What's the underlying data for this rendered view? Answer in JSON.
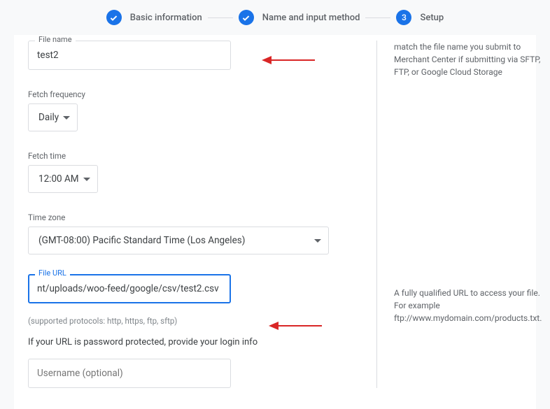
{
  "stepper": {
    "step1": "Basic information",
    "step2": "Name and input method",
    "step3_num": "3",
    "step3": "Setup"
  },
  "form": {
    "file_name_label": "File name",
    "file_name_value": "test2",
    "fetch_freq_label": "Fetch frequency",
    "fetch_freq_value": "Daily",
    "fetch_time_label": "Fetch time",
    "fetch_time_value": "12:00 AM",
    "time_zone_label": "Time zone",
    "time_zone_value": "(GMT-08:00) Pacific Standard Time (Los Angeles)",
    "file_url_label": "File URL",
    "file_url_value": "nt/uploads/woo-feed/google/csv/test2.csv",
    "protocols_helper": "(supported protocols: http, https, ftp, sftp)",
    "login_prompt": "If your URL is password protected, provide your login info",
    "username_placeholder": "Username (optional)"
  },
  "tips": {
    "file_name": "match the file name you submit to Merchant Center if submitting via SFTP, FTP, or Google Cloud Storage",
    "file_url": "A fully qualified URL to access your file. For example ftp://www.mydomain.com/products.txt."
  }
}
